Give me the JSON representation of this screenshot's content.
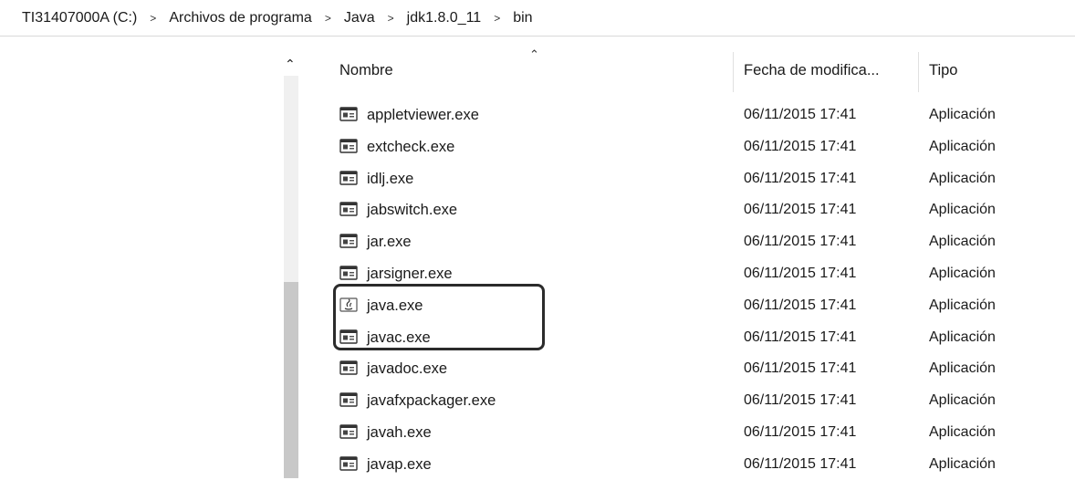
{
  "breadcrumb": {
    "items": [
      "TI31407000A (C:)",
      "Archivos de programa",
      "Java",
      "jdk1.8.0_11",
      "bin"
    ],
    "separator": ">"
  },
  "columns": {
    "name": "Nombre",
    "date": "Fecha de modifica...",
    "type": "Tipo"
  },
  "files": [
    {
      "name": "appletviewer.exe",
      "date": "06/11/2015 17:41",
      "type": "Aplicación",
      "icon": "exe-icon"
    },
    {
      "name": "extcheck.exe",
      "date": "06/11/2015 17:41",
      "type": "Aplicación",
      "icon": "exe-icon"
    },
    {
      "name": "idlj.exe",
      "date": "06/11/2015 17:41",
      "type": "Aplicación",
      "icon": "exe-icon"
    },
    {
      "name": "jabswitch.exe",
      "date": "06/11/2015 17:41",
      "type": "Aplicación",
      "icon": "exe-icon"
    },
    {
      "name": "jar.exe",
      "date": "06/11/2015 17:41",
      "type": "Aplicación",
      "icon": "exe-icon"
    },
    {
      "name": "jarsigner.exe",
      "date": "06/11/2015 17:41",
      "type": "Aplicación",
      "icon": "exe-icon"
    },
    {
      "name": "java.exe",
      "date": "06/11/2015 17:41",
      "type": "Aplicación",
      "icon": "java-cup-icon"
    },
    {
      "name": "javac.exe",
      "date": "06/11/2015 17:41",
      "type": "Aplicación",
      "icon": "exe-icon"
    },
    {
      "name": "javadoc.exe",
      "date": "06/11/2015 17:41",
      "type": "Aplicación",
      "icon": "exe-icon"
    },
    {
      "name": "javafxpackager.exe",
      "date": "06/11/2015 17:41",
      "type": "Aplicación",
      "icon": "exe-icon"
    },
    {
      "name": "javah.exe",
      "date": "06/11/2015 17:41",
      "type": "Aplicación",
      "icon": "exe-icon"
    },
    {
      "name": "javap.exe",
      "date": "06/11/2015 17:41",
      "type": "Aplicación",
      "icon": "exe-icon"
    }
  ],
  "highlighted_files": [
    "java.exe",
    "javac.exe"
  ],
  "colors": {
    "highlight_border": "#2b2b2b",
    "scroll_thumb": "#c8c8c8"
  }
}
